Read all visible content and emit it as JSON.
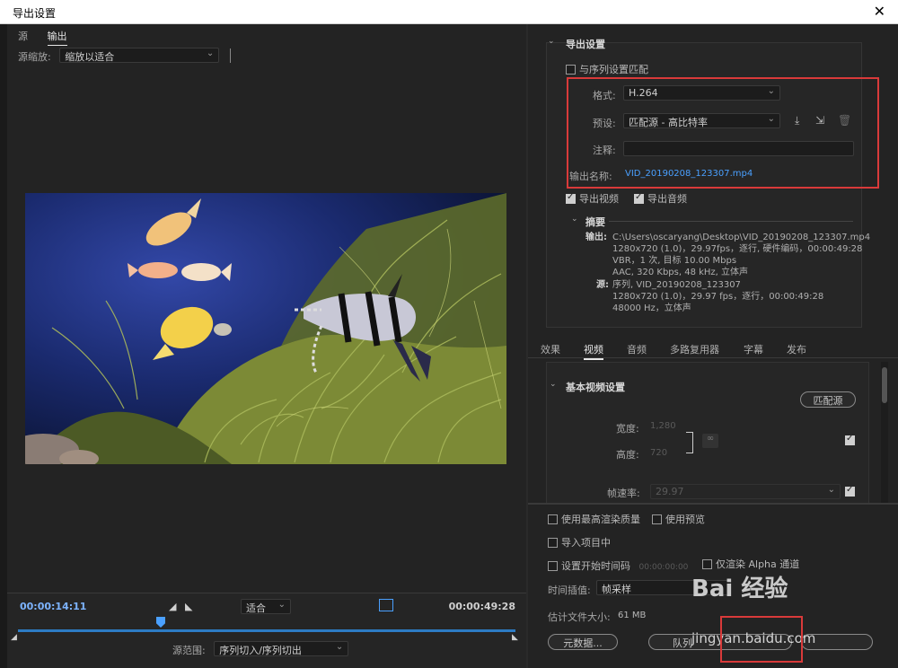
{
  "window": {
    "title": "导出设置",
    "close_glyph": "✕"
  },
  "left": {
    "tabs": [
      {
        "label": "源"
      },
      {
        "label": "输出"
      }
    ],
    "scale_label": "源缩放:",
    "scale_value": "缩放以适合",
    "timecode_in": "00:00:14:11",
    "timecode_out": "00:00:49:28",
    "fit_value": "适合",
    "range_label": "源范围:",
    "range_value": "序列切入/序列切出"
  },
  "export": {
    "section_title": "导出设置",
    "match_seq": "与序列设置匹配",
    "format_label": "格式:",
    "format_value": "H.264",
    "preset_label": "预设:",
    "preset_value": "匹配源 - 高比特率",
    "comment_label": "注释:",
    "comment_value": "",
    "output_name_label": "输出名称:",
    "output_name_value": "VID_20190208_123307.mp4",
    "export_video": "导出视频",
    "export_audio": "导出音频",
    "summary_title": "摘要",
    "output_label": "输出:",
    "output_lines": [
      "C:\\Users\\oscaryang\\Desktop\\VID_20190208_123307.mp4",
      "1280x720 (1.0)，29.97fps，逐行, 硬件编码，00:00:49:28",
      "VBR，1 次, 目标 10.00 Mbps",
      "AAC, 320 Kbps, 48  kHz, 立体声"
    ],
    "source_label": "源:",
    "source_lines": [
      "序列, VID_20190208_123307",
      "1280x720 (1.0)，29.97 fps，逐行，00:00:49:28",
      "48000  Hz，立体声"
    ]
  },
  "tabs_mid": [
    {
      "label": "效果"
    },
    {
      "label": "视频"
    },
    {
      "label": "音频"
    },
    {
      "label": "多路复用器"
    },
    {
      "label": "字幕"
    },
    {
      "label": "发布"
    }
  ],
  "video": {
    "section_title": "基本视频设置",
    "match_source_btn": "匹配源",
    "width_label": "宽度:",
    "width_value": "1,280",
    "height_label": "高度:",
    "height_value": "720",
    "fps_label": "帧速率:",
    "fps_value": "29.97"
  },
  "bottom": {
    "max_render": "使用最高渲染质量",
    "use_preview": "使用预览",
    "import_project": "导入项目中",
    "set_start_tc": "设置开始时间码",
    "start_tc_value": "00:00:00:00",
    "alpha_only": "仅渲染 Alpha 通道",
    "interp_label": "时间插值:",
    "interp_value": "帧采样",
    "filesize_label": "估计文件大小:",
    "filesize_value": "61 MB",
    "metadata_btn": "元数据...",
    "queue_btn": "队列"
  },
  "watermark": {
    "line1": "Bai 经验",
    "line2": "jingyan.baidu.com"
  }
}
